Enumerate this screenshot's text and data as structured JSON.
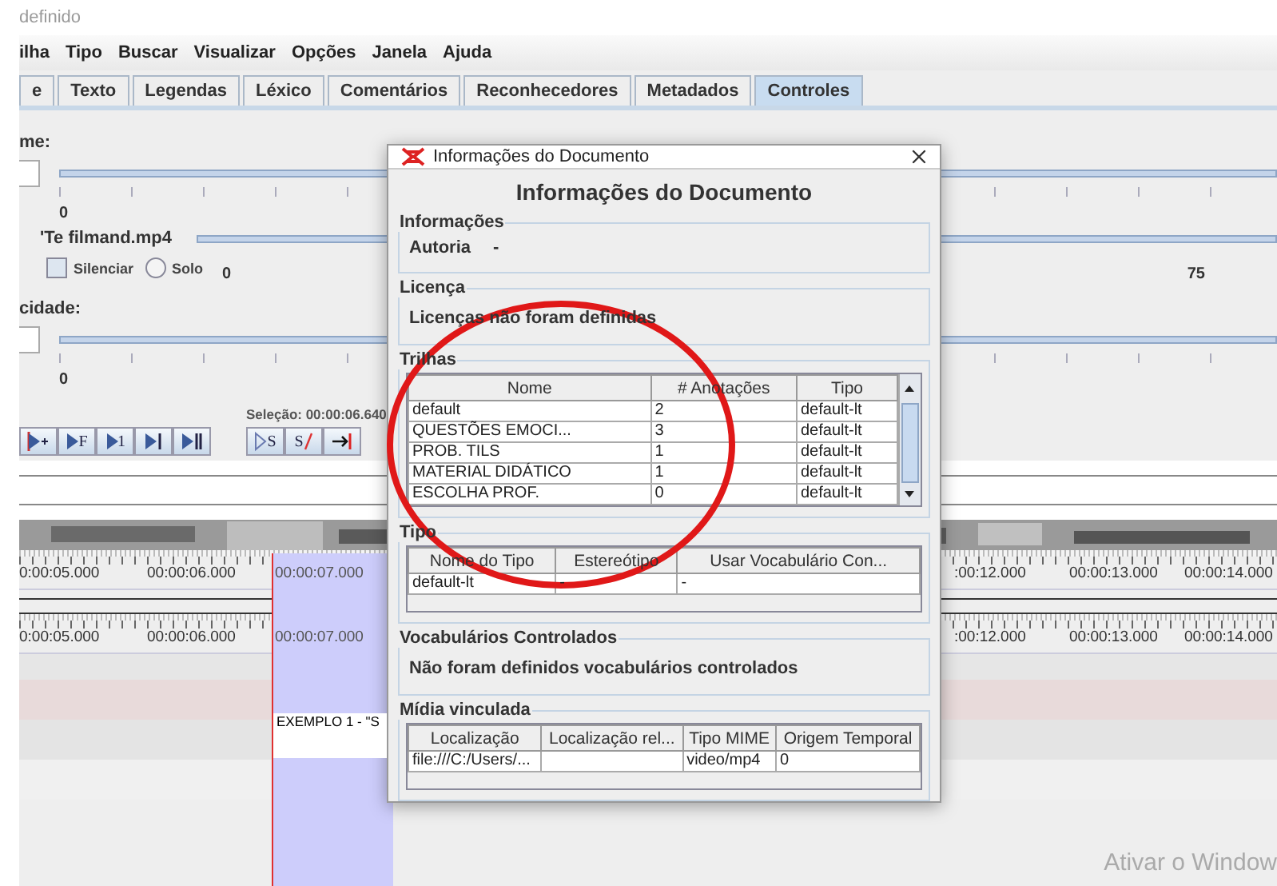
{
  "window": {
    "title": "definido"
  },
  "menu": [
    "ilha",
    "Tipo",
    "Buscar",
    "Visualizar",
    "Opções",
    "Janela",
    "Ajuda"
  ],
  "tabs": [
    {
      "label": "e",
      "selected": false
    },
    {
      "label": "Texto",
      "selected": false
    },
    {
      "label": "Legendas",
      "selected": false
    },
    {
      "label": "Léxico",
      "selected": false
    },
    {
      "label": "Comentários",
      "selected": false
    },
    {
      "label": "Reconhecedores",
      "selected": false
    },
    {
      "label": "Metadados",
      "selected": false
    },
    {
      "label": "Controles",
      "selected": true
    }
  ],
  "controls": {
    "volume_label": "me:",
    "volume_min": "0",
    "media_name": "'Te filmand.mp4",
    "mute": {
      "label": "Silenciar",
      "checked": false
    },
    "solo": {
      "label": "Solo",
      "selected": false
    },
    "media_min": "0",
    "media_mark": "75",
    "rate_label": "cidade:",
    "rate_min": "0"
  },
  "player": {
    "selection": "Seleção: 00:00:06.640",
    "play_buttons": [
      {
        "kind": "play-plus"
      },
      {
        "kind": "play",
        "label": "F"
      },
      {
        "kind": "play",
        "label": "1"
      },
      {
        "kind": "play-end"
      },
      {
        "kind": "play-pause"
      }
    ],
    "selection_buttons": [
      {
        "kind": "outline-play",
        "label": "S"
      },
      {
        "kind": "strike",
        "label": "S"
      },
      {
        "kind": "to-end"
      }
    ]
  },
  "timeline": {
    "rulers": [
      {
        "left": [
          "0:00:05.000",
          "00:00:06.000",
          "00:00:07.000"
        ],
        "right": [
          ":00:12.000",
          "00:00:13.000",
          "00:00:14.000"
        ]
      },
      {
        "left": [
          "0:00:05.000",
          "00:00:06.000",
          "00:00:07.000"
        ],
        "right": [
          ":00:12.000",
          "00:00:13.000",
          "00:00:14.000"
        ]
      }
    ],
    "annotation": "EXEMPLO 1 - \"S"
  },
  "dialog": {
    "title": "Informações do Documento",
    "heading": "Informações do Documento",
    "sections": [
      {
        "kind": "fields",
        "title": "Informações",
        "fields": [
          {
            "label": "Autoria",
            "value": "-"
          }
        ]
      },
      {
        "kind": "text",
        "title": "Licença",
        "text": "Licenças não foram definidas"
      },
      {
        "kind": "table",
        "title": "Trilhas",
        "scrollbar": true,
        "columns": [
          "Nome",
          "# Anotações",
          "Tipo"
        ],
        "rows": [
          [
            "default",
            "2",
            "default-lt"
          ],
          [
            "QUESTÕES EMOCI...",
            "3",
            "default-lt"
          ],
          [
            "PROB. TILS",
            "1",
            "default-lt"
          ],
          [
            "MATERIAL DIDÁTICO",
            "1",
            "default-lt"
          ],
          [
            "ESCOLHA PROF.",
            "0",
            "default-lt"
          ]
        ]
      },
      {
        "kind": "table",
        "title": "Tipo",
        "scrollbar": false,
        "columns": [
          "Nome do Tipo",
          "Estereótipo",
          "Usar Vocabulário Con..."
        ],
        "rows": [
          [
            "default-lt",
            "-",
            "-"
          ]
        ]
      },
      {
        "kind": "text",
        "title": "Vocabulários Controlados",
        "text": "Não foram definidos vocabulários controlados"
      },
      {
        "kind": "table",
        "title": "Mídia vinculada",
        "scrollbar": false,
        "columns": [
          "Localização",
          "Localização rel...",
          "Tipo MIME",
          "Origem Temporal"
        ],
        "rows": [
          [
            "file:///C:/Users/...",
            null,
            "video/mp4",
            "0"
          ]
        ]
      }
    ]
  },
  "watermark": "Ativar o Window"
}
